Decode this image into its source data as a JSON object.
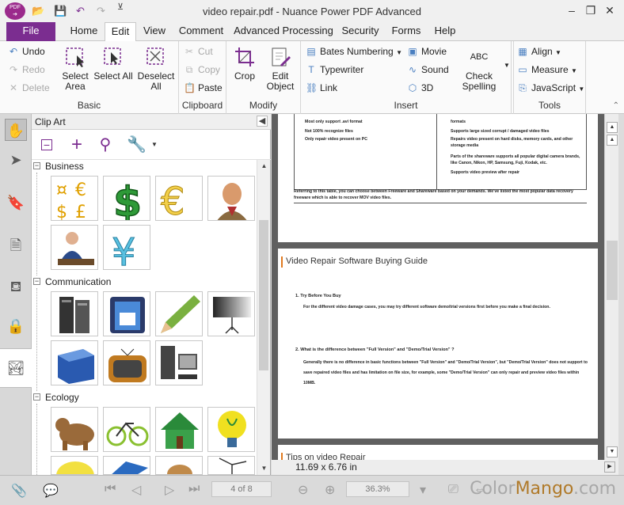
{
  "window": {
    "title": "video repair.pdf - Nuance Power PDF Advanced",
    "logo_text": "PDF",
    "controls": [
      "–",
      "❐",
      "✕"
    ]
  },
  "menu": {
    "tabs": [
      "File",
      "Home",
      "Edit",
      "View",
      "Comment",
      "Advanced Processing",
      "Security",
      "Forms",
      "Help"
    ],
    "active": "Edit"
  },
  "ribbon": {
    "basic": {
      "title": "Basic",
      "undo": "Undo",
      "redo": "Redo",
      "delete": "Delete",
      "select_area_1": "Select",
      "select_area_2": "Area",
      "select_all": "Select All",
      "deselect_1": "Deselect",
      "deselect_2": "All"
    },
    "clipboard": {
      "title": "Clipboard",
      "cut": "Cut",
      "copy": "Copy",
      "paste": "Paste"
    },
    "modify": {
      "title": "Modify",
      "crop": "Crop",
      "edit_object_1": "Edit",
      "edit_object_2": "Object"
    },
    "insert": {
      "title": "Insert",
      "bates": "Bates Numbering",
      "typewriter": "Typewriter",
      "link": "Link",
      "movie": "Movie",
      "sound": "Sound",
      "three_d": "3D",
      "check_1": "Check",
      "check_2": "Spelling",
      "abc": "ABC"
    },
    "tools": {
      "title": "Tools",
      "align": "Align",
      "measure": "Measure",
      "javascript": "JavaScript"
    }
  },
  "panel": {
    "title": "Clip Art",
    "categories": [
      {
        "name": "Business",
        "toggle": "−"
      },
      {
        "name": "Communication",
        "toggle": "−"
      },
      {
        "name": "Ecology",
        "toggle": "−"
      }
    ]
  },
  "document": {
    "page1_lines_left": [
      "Most only support .avi format",
      "Not 100% recognize files",
      "Only repair video present on PC"
    ],
    "page1_lines_right": [
      "formats",
      "Supports large sized corrupt / damaged video files",
      "Repairs video present on hard disks, memory cards, and other storage media",
      "Parts of the shareware supports all popular digital camera brands, like Canon, Nikon, HP, Samsung, Fuji, Kodak, etc.",
      "Supports video preview after repair"
    ],
    "page1_footer": "Referring to this table, you can choose between Freeware and Shareware based on your demands. We've listed the most popular data recovery freeware which is able to recover MOV video files.",
    "page2_heading": "Video Repair Software Buying Guide",
    "item1_title": "1.   Try Before You Buy",
    "item1_body": "For the different video damage cases, you may try different software demo/trial versions first before you make a final decision.",
    "item2_title": "2.   What is the difference between \"Full Version\" and \"Demo/Trial Version\" ?",
    "item2_body": "Generally there is no difference in basic functions between \"Full Version\" and \"Demo/Trial Version\", but \"Demo/Trial Version\" does not support to save repaired video files and has limitation on file size, for example, some \"Demo/Trial Version\" can only repair and preview video files within 10MB.",
    "page3_heading": "Tips on video Repair",
    "page_size": "11.69 x 6.76 in"
  },
  "status": {
    "page_indicator": "4 of 8",
    "zoom": "36.3%",
    "watermark_a": "Color",
    "watermark_b": "Mango",
    "watermark_c": ".com"
  },
  "colors": {
    "accent": "#7b2d90",
    "ribbon_icon": "#4a7fc0",
    "heading_bar": "#e07a20"
  }
}
